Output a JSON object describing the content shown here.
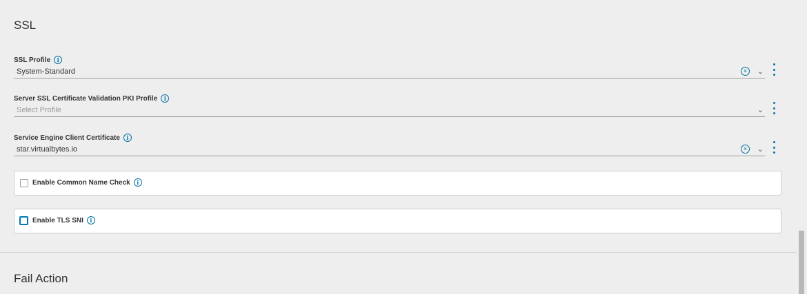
{
  "ssl": {
    "title": "SSL",
    "info_glyph": "i",
    "clear_glyph": "×",
    "chevron_glyph": "⌄",
    "fields": [
      {
        "label": "SSL Profile",
        "value": "System-Standard",
        "has_clear": true
      },
      {
        "label": "Server SSL Certificate Validation PKI Profile",
        "placeholder": "Select Profile",
        "has_clear": false
      },
      {
        "label": "Service Engine Client Certificate",
        "value": "star.virtualbytes.io",
        "has_clear": true
      }
    ],
    "checkboxes": [
      {
        "label": "Enable Common Name Check",
        "checked": false
      },
      {
        "label": "Enable TLS SNI",
        "checked": false,
        "focused": true
      }
    ]
  },
  "fail_action": {
    "title": "Fail Action"
  },
  "colors": {
    "accent": "#0072a3",
    "background": "#eeeeee",
    "card": "#ffffff"
  },
  "icons": [
    "info-icon",
    "clear-icon",
    "chevron-down-icon",
    "kebab-menu-icon",
    "checkbox"
  ]
}
